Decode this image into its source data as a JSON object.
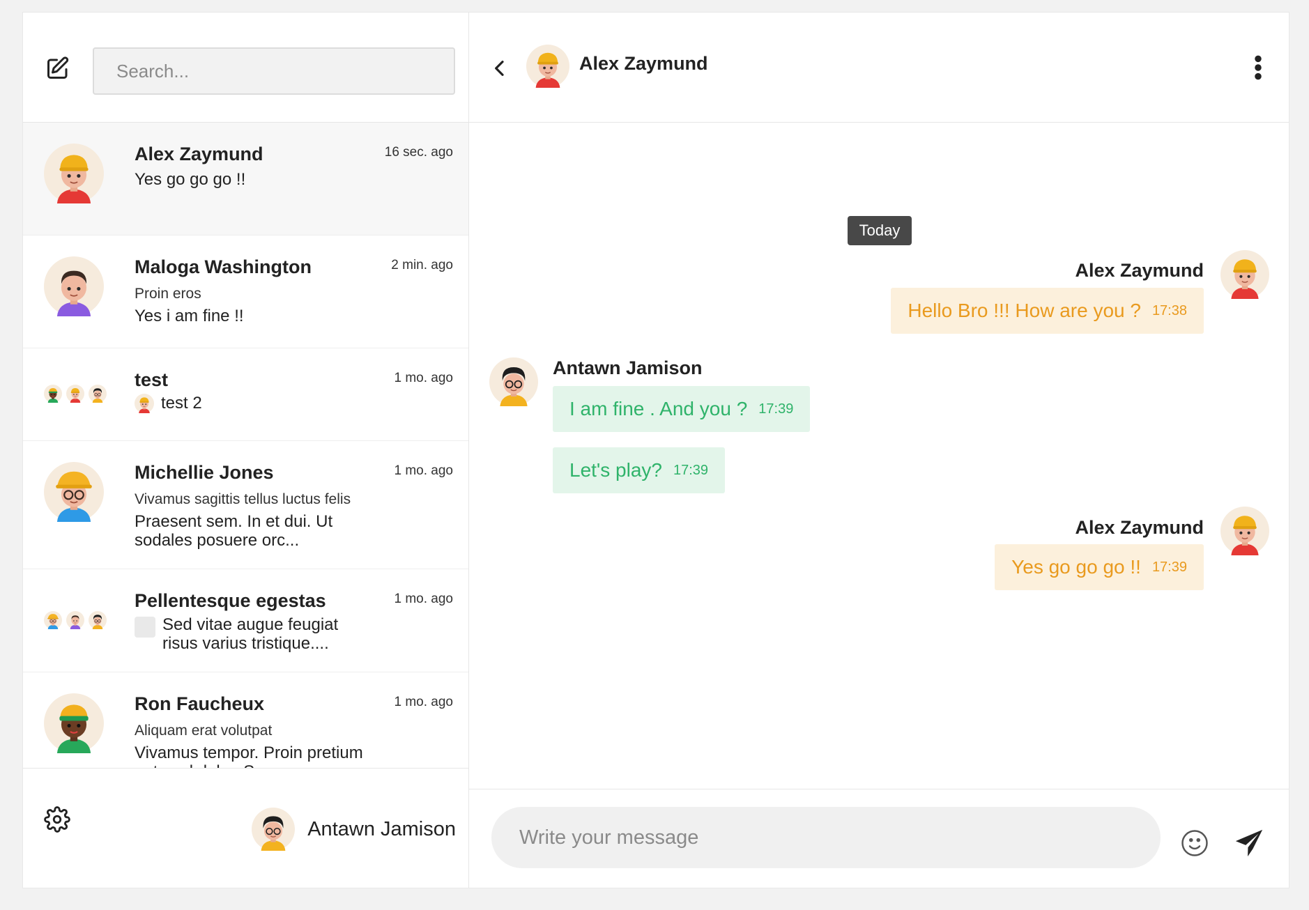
{
  "search": {
    "placeholder": "Search..."
  },
  "conversations": [
    {
      "name": "Alex Zaymund",
      "time": "16 sec. ago",
      "preview": "Yes go go go !!"
    },
    {
      "name": "Maloga Washington",
      "time": "2 min. ago",
      "subtitle": "Proin eros",
      "preview": "Yes i am fine !!"
    },
    {
      "name": "test",
      "time": "1 mo. ago",
      "preview": "test 2"
    },
    {
      "name": "Michellie Jones",
      "time": "1 mo. ago",
      "subtitle": "Vivamus sagittis tellus luctus felis",
      "preview": "Praesent sem. In et dui. Ut sodales posuere orc..."
    },
    {
      "name": "Pellentesque egestas",
      "time": "1 mo. ago",
      "preview": "Sed vitae augue feugiat risus varius tristique...."
    },
    {
      "name": "Ron Faucheux",
      "time": "1 mo. ago",
      "subtitle": "Aliquam erat volutpat",
      "preview": "Vivamus tempor. Proin pretium ante vel dolor. S..."
    }
  ],
  "current_user": {
    "name": "Antawn Jamison"
  },
  "chat": {
    "contact_name": "Alex Zaymund",
    "day_separator": "Today",
    "messages": [
      {
        "sender": "Alex Zaymund",
        "text": "Hello Bro !!! How are you ?",
        "time": "17:38",
        "direction": "outgoing"
      },
      {
        "sender": "Antawn Jamison",
        "text": "I am fine . And you ?",
        "time": "17:39",
        "direction": "incoming"
      },
      {
        "sender": "Antawn Jamison",
        "text": "Let's play?",
        "time": "17:39",
        "direction": "incoming"
      },
      {
        "sender": "Alex Zaymund",
        "text": "Yes go go go !!",
        "time": "17:39",
        "direction": "outgoing"
      }
    ]
  },
  "composer": {
    "placeholder": "Write your message"
  },
  "icons": {
    "compose": "pencil-square-icon",
    "back": "chevron-left-icon",
    "more": "dots-vertical-icon",
    "settings": "gear-icon",
    "emoji": "smiley-icon",
    "send": "paper-plane-icon"
  },
  "colors": {
    "outgoing_bubble_bg": "#fcf0dc",
    "outgoing_text": "#e99a1e",
    "incoming_bubble_bg": "#e3f5ea",
    "incoming_text": "#2fb36a",
    "day_pill_bg": "#484848"
  }
}
